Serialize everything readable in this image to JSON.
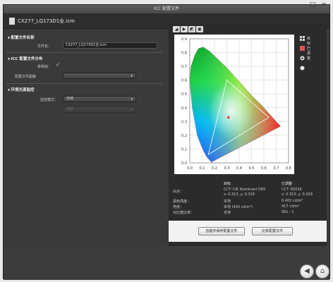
{
  "window": {
    "title": "ICC 配置文件",
    "controls": [
      "–",
      "□",
      "×"
    ]
  },
  "header": {
    "file_name": "CX277_LQ173D1全.icm"
  },
  "left": {
    "sections": {
      "profile_name": "配置文件名称",
      "distribution": "ICC 配置文件分布",
      "ambient": "环境光源监控"
    },
    "file_label": "文件名：",
    "file_value": "CX277_LQ173D1全.icm",
    "system_label": "系统级：",
    "system_check": "✓",
    "profile_select_label": "配置文件副解",
    "profile_select_value": "",
    "monitor_mode_label": "监控模式：",
    "monitor_mode_value": "无效",
    "disabled_label": "",
    "disabled_value": "无效"
  },
  "toolbar_tabs": [
    "◢",
    "▶",
    "◩",
    "▣"
  ],
  "legend": {
    "target": "目标",
    "adjusted": "已调整",
    "icon_target": "grid-icon",
    "icon_adjusted": "square-icon"
  },
  "info": {
    "col_target": "目标",
    "col_adjusted": "已调整",
    "white_label": "白点：",
    "white_target_cct": "CCT: CIE Illuminant D65",
    "white_target_xy": "x: 0.313, y: 0.329",
    "white_adjusted_cct": "CCT: 6503K",
    "white_adjusted_xy": "x: 0.313, y: 0.329",
    "black_label": "黑色亮度：",
    "black_target": "本地",
    "black_adjusted": "0.402 cd/m²",
    "lum_label": "亮度：",
    "lum_target": "本地 (420 cd/m²)",
    "lum_adjusted": "417 cd/m²",
    "contrast_label": "对比度比率：",
    "contrast_target": "本地",
    "contrast_adjusted": "991 : 1"
  },
  "buttons": {
    "save_profile": "创建并保存配置文件",
    "export_profile": "比较配置文件"
  },
  "nav": {
    "back": "◀",
    "home": "⌂"
  },
  "chart_data": {
    "type": "scatter",
    "title": "",
    "xlabel": "",
    "ylabel": "",
    "xlim": [
      0.0,
      0.8
    ],
    "ylim": [
      0.0,
      0.9
    ],
    "xticks": [
      "0.0",
      "0.1",
      "0.2",
      "0.3",
      "0.4",
      "0.5",
      "0.6",
      "0.7",
      "0.8"
    ],
    "yticks": [
      "0.0",
      "0.1",
      "0.2",
      "0.3",
      "0.4",
      "0.5",
      "0.6",
      "0.7",
      "0.8",
      "0.9"
    ],
    "spectral_locus": [
      [
        0.175,
        0.005
      ],
      [
        0.17,
        0.01
      ],
      [
        0.16,
        0.02
      ],
      [
        0.14,
        0.04
      ],
      [
        0.12,
        0.07
      ],
      [
        0.09,
        0.13
      ],
      [
        0.06,
        0.2
      ],
      [
        0.04,
        0.3
      ],
      [
        0.02,
        0.4
      ],
      [
        0.01,
        0.5
      ],
      [
        0.0,
        0.6
      ],
      [
        0.01,
        0.7
      ],
      [
        0.04,
        0.78
      ],
      [
        0.07,
        0.83
      ],
      [
        0.11,
        0.84
      ],
      [
        0.16,
        0.81
      ],
      [
        0.23,
        0.75
      ],
      [
        0.3,
        0.69
      ],
      [
        0.37,
        0.62
      ],
      [
        0.44,
        0.55
      ],
      [
        0.51,
        0.48
      ],
      [
        0.58,
        0.42
      ],
      [
        0.64,
        0.36
      ],
      [
        0.7,
        0.3
      ],
      [
        0.735,
        0.265
      ]
    ],
    "gamut_points": [
      [
        0.64,
        0.33
      ],
      [
        0.3,
        0.6
      ],
      [
        0.15,
        0.06
      ]
    ],
    "white_point": [
      0.313,
      0.329
    ],
    "grid": true
  }
}
